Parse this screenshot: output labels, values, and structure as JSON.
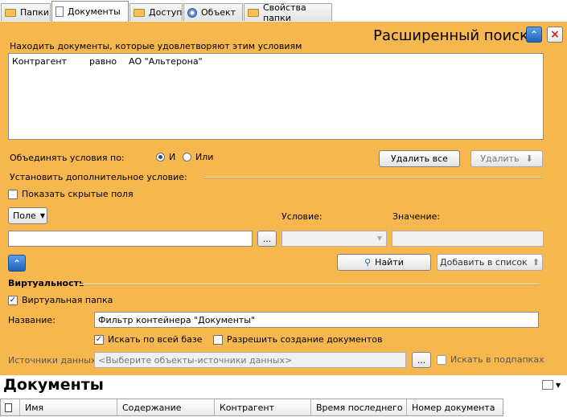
{
  "tabs": [
    {
      "label": "Папки",
      "icon": "folder-icon"
    },
    {
      "label": "Документы",
      "icon": "document-icon",
      "active": true
    },
    {
      "label": "Доступ",
      "icon": "folder-lock-icon"
    },
    {
      "label": "Объект",
      "icon": "gear-icon"
    },
    {
      "label": "Свойства папки",
      "icon": "folder-icon"
    }
  ],
  "search": {
    "title": "Расширенный поиск",
    "find_label": "Находить документы, которые удовлетворяют этим условиям",
    "condition": {
      "field": "Контрагент",
      "operator": "равно",
      "value": "АО \"Альтерона\""
    },
    "combine_label": "Объединять условия по:",
    "and_label": "И",
    "or_label": "Или",
    "delete_all": "Удалить все",
    "delete": "Удалить",
    "add_condition_label": "Установить дополнительное условие:",
    "show_hidden": "Показать скрытые поля",
    "field_dropdown": "Поле",
    "condition_label": "Условие:",
    "value_label": "Значение:",
    "ellipsis": "...",
    "find_button": "Найти",
    "add_to_list": "Добавить в список"
  },
  "virtual": {
    "section": "Виртуальность",
    "virtual_folder": "Виртуальная папка",
    "name_label": "Название:",
    "name_value": "Фильтр контейнера \"Документы\"",
    "search_all": "Искать по всей базе",
    "allow_create": "Разрешить создание документов",
    "sources_label": "Источники данных:",
    "sources_placeholder": "<Выберите объекты-источники данных>",
    "ellipsis": "...",
    "search_subfolders": "Искать в подпапках"
  },
  "docs": {
    "title": "Документы",
    "columns": [
      "Имя",
      "Содержание",
      "Контрагент",
      "Время последнего ...",
      "Номер документа"
    ]
  },
  "colors": {
    "panel": "#f6b74e",
    "accent": "#1d62bd"
  }
}
